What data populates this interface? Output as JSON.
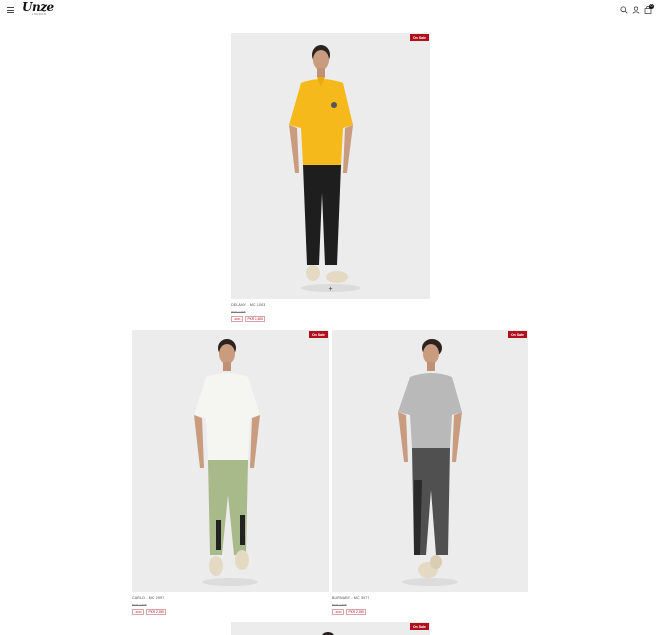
{
  "header": {
    "logo": "Unze",
    "logo_sub": "LONDON",
    "cart_count": "0",
    "icons": [
      "menu-icon",
      "search-icon",
      "user-icon",
      "bag-icon"
    ]
  },
  "products": [
    {
      "badge": "On Sale",
      "name": "DELANY - MC 1003",
      "old_price": "PKR 2,695",
      "discount": "-40% ",
      "price": "PKR 1,605",
      "shirt_color": "#f6b91c",
      "pants_color": "#1e1e1e"
    },
    {
      "badge": "On Sale",
      "name": "CARLO - MC 2997",
      "old_price": "PKR 3,995",
      "discount": "-40% ",
      "price": "PKR 2,395",
      "shirt_color": "#f5f5f2",
      "pants_color": "#a8b98a"
    },
    {
      "badge": "On Sale",
      "name": "BURNABY - MC 3977",
      "old_price": "PKR 3,995",
      "discount": "-40% ",
      "price": "PKR 2,395",
      "shirt_color": "#b9b9b9",
      "pants_color": "#505050"
    },
    {
      "badge": "On Sale"
    }
  ]
}
